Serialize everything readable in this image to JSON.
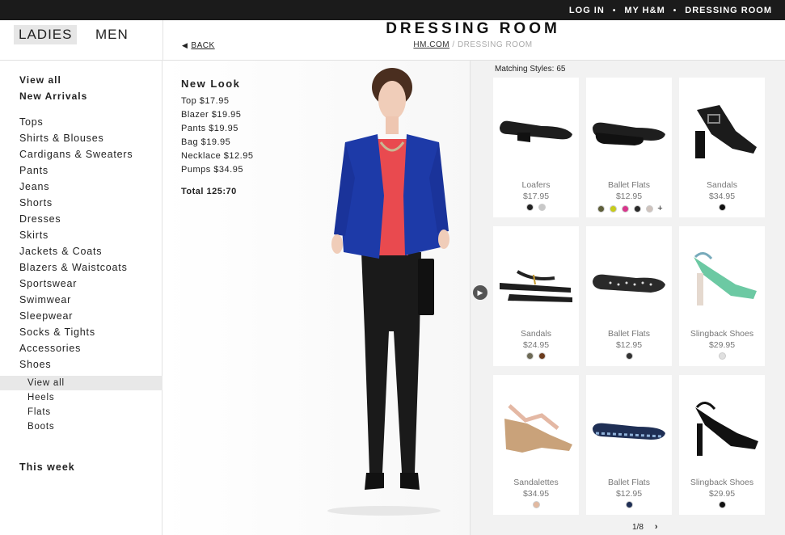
{
  "topnav": {
    "login": "LOG IN",
    "myhm": "MY H&M",
    "dressing": "DRESSING ROOM",
    "sep": "•"
  },
  "header": {
    "ladies": "LADIES",
    "men": "MEN",
    "back": "BACK",
    "title": "DRESSING ROOM",
    "crumb_home": "HM.COM",
    "crumb_sep": "/",
    "crumb_current": "DRESSING ROOM"
  },
  "sidebar": {
    "view_all": "View all",
    "new_arrivals": "New Arrivals",
    "categories": [
      "Tops",
      "Shirts & Blouses",
      "Cardigans & Sweaters",
      "Pants",
      "Jeans",
      "Shorts",
      "Dresses",
      "Skirts",
      "Jackets & Coats",
      "Blazers & Waistcoats",
      "Sportswear",
      "Swimwear",
      "Sleepwear",
      "Socks & Tights",
      "Accessories",
      "Shoes"
    ],
    "shoes_sub": [
      "View all",
      "Heels",
      "Flats",
      "Boots"
    ],
    "this_week": "This week"
  },
  "look": {
    "title": "New Look",
    "items": [
      "Top $17.95",
      "Blazer $19.95",
      "Pants $19.95",
      "Bag $19.95",
      "Necklace $12.95",
      "Pumps $34.95"
    ],
    "total": "Total 125:70"
  },
  "products": {
    "matching_label": "Matching Styles:",
    "matching_count": "65",
    "items": [
      {
        "name": "Loafers",
        "price": "$17.95",
        "icon": "loafer-shoe",
        "swatches": [
          "#222222",
          "#c8c8c8"
        ],
        "more": false
      },
      {
        "name": "Ballet Flats",
        "price": "$12.95",
        "icon": "ballet-flat-shoe",
        "swatches": [
          "#5e5f3a",
          "#c7cc1a",
          "#d8368c",
          "#2a2a2a",
          "#cfc3bd"
        ],
        "more": true
      },
      {
        "name": "Sandals",
        "price": "$34.95",
        "icon": "heeled-sandal",
        "swatches": [
          "#111111"
        ],
        "more": false
      },
      {
        "name": "Sandals",
        "price": "$24.95",
        "icon": "flat-sandal",
        "swatches": [
          "#6d6a55",
          "#6b3b1d"
        ],
        "more": false
      },
      {
        "name": "Ballet Flats",
        "price": "$12.95",
        "icon": "dotted-ballet-flat",
        "swatches": [
          "#333333"
        ],
        "more": false
      },
      {
        "name": "Slingback Shoes",
        "price": "$29.95",
        "icon": "slingback-green",
        "swatches": [
          "#e0e0e0"
        ],
        "more": false
      },
      {
        "name": "Sandalettes",
        "price": "$34.95",
        "icon": "wedge-sandalette",
        "swatches": [
          "#e2b9a0"
        ],
        "more": false
      },
      {
        "name": "Ballet Flats",
        "price": "$12.95",
        "icon": "navy-ballet-flat",
        "swatches": [
          "#1f2f55"
        ],
        "more": false
      },
      {
        "name": "Slingback Shoes",
        "price": "$29.95",
        "icon": "slingback-black",
        "swatches": [
          "#111111"
        ],
        "more": false
      }
    ],
    "more_symbol": "+",
    "page": "1/8",
    "next_symbol": "›"
  },
  "colors": {
    "topbar": "#1b1b1b",
    "blazer": "#1d3aa8",
    "top": "#e94a4f",
    "pants": "#1a1a1a"
  }
}
